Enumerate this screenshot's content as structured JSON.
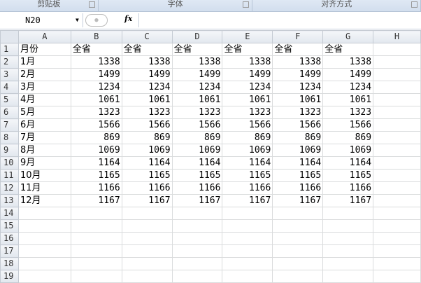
{
  "ribbon_groups": [
    "剪贴板",
    "字体",
    "对齐方式"
  ],
  "name_box": "N20",
  "formula": "",
  "columns": [
    "A",
    "B",
    "C",
    "D",
    "E",
    "F",
    "G",
    "H"
  ],
  "rows": [
    [
      "月份",
      "全省",
      "全省",
      "全省",
      "全省",
      "全省",
      "全省"
    ],
    [
      "1月",
      "1338",
      "1338",
      "1338",
      "1338",
      "1338",
      "1338"
    ],
    [
      "2月",
      "1499",
      "1499",
      "1499",
      "1499",
      "1499",
      "1499"
    ],
    [
      "3月",
      "1234",
      "1234",
      "1234",
      "1234",
      "1234",
      "1234"
    ],
    [
      "4月",
      "1061",
      "1061",
      "1061",
      "1061",
      "1061",
      "1061"
    ],
    [
      "5月",
      "1323",
      "1323",
      "1323",
      "1323",
      "1323",
      "1323"
    ],
    [
      "6月",
      "1566",
      "1566",
      "1566",
      "1566",
      "1566",
      "1566"
    ],
    [
      "7月",
      "869",
      "869",
      "869",
      "869",
      "869",
      "869"
    ],
    [
      "8月",
      "1069",
      "1069",
      "1069",
      "1069",
      "1069",
      "1069"
    ],
    [
      "9月",
      "1164",
      "1164",
      "1164",
      "1164",
      "1164",
      "1164"
    ],
    [
      "10月",
      "1165",
      "1165",
      "1165",
      "1165",
      "1165",
      "1165"
    ],
    [
      "11月",
      "1166",
      "1166",
      "1166",
      "1166",
      "1166",
      "1166"
    ],
    [
      "12月",
      "1167",
      "1167",
      "1167",
      "1167",
      "1167",
      "1167"
    ]
  ],
  "row_count": 19
}
